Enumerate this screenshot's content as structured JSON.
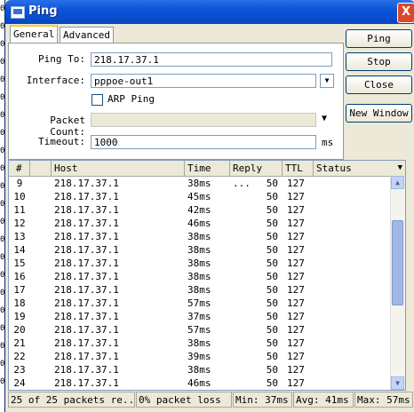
{
  "background_window": {
    "fragments": [
      "0",
      "0",
      "0",
      "0",
      "0",
      "0",
      "0",
      "0",
      "0",
      "0",
      "0",
      "0",
      "0",
      "0",
      "0",
      "0",
      "0",
      "0",
      "0",
      "0",
      "0",
      "0"
    ]
  },
  "window": {
    "title": "Ping",
    "close_glyph": "X"
  },
  "tabs": [
    {
      "label": "General"
    },
    {
      "label": "Advanced"
    }
  ],
  "form": {
    "ping_to_label": "Ping To:",
    "ping_to_value": "218.17.37.1",
    "interface_label": "Interface:",
    "interface_value": "pppoe-out1",
    "arp_ping_label": "ARP Ping",
    "packet_count_label": "Packet Count:",
    "packet_count_value": "",
    "timeout_label": "Timeout:",
    "timeout_value": "1000",
    "timeout_unit": "ms"
  },
  "buttons": {
    "ping": "Ping",
    "stop": "Stop",
    "close": "Close",
    "new_window": "New Window"
  },
  "table": {
    "columns": [
      "#",
      "Host",
      "Time",
      "Reply ...",
      "TTL",
      "Status"
    ],
    "rows": [
      {
        "n": "9",
        "host": "218.17.37.1",
        "time": "38ms",
        "reply": "50",
        "ttl": "127",
        "status": ""
      },
      {
        "n": "10",
        "host": "218.17.37.1",
        "time": "45ms",
        "reply": "50",
        "ttl": "127",
        "status": ""
      },
      {
        "n": "11",
        "host": "218.17.37.1",
        "time": "42ms",
        "reply": "50",
        "ttl": "127",
        "status": ""
      },
      {
        "n": "12",
        "host": "218.17.37.1",
        "time": "46ms",
        "reply": "50",
        "ttl": "127",
        "status": ""
      },
      {
        "n": "13",
        "host": "218.17.37.1",
        "time": "38ms",
        "reply": "50",
        "ttl": "127",
        "status": ""
      },
      {
        "n": "14",
        "host": "218.17.37.1",
        "time": "38ms",
        "reply": "50",
        "ttl": "127",
        "status": ""
      },
      {
        "n": "15",
        "host": "218.17.37.1",
        "time": "38ms",
        "reply": "50",
        "ttl": "127",
        "status": ""
      },
      {
        "n": "16",
        "host": "218.17.37.1",
        "time": "38ms",
        "reply": "50",
        "ttl": "127",
        "status": ""
      },
      {
        "n": "17",
        "host": "218.17.37.1",
        "time": "38ms",
        "reply": "50",
        "ttl": "127",
        "status": ""
      },
      {
        "n": "18",
        "host": "218.17.37.1",
        "time": "57ms",
        "reply": "50",
        "ttl": "127",
        "status": ""
      },
      {
        "n": "19",
        "host": "218.17.37.1",
        "time": "37ms",
        "reply": "50",
        "ttl": "127",
        "status": ""
      },
      {
        "n": "20",
        "host": "218.17.37.1",
        "time": "57ms",
        "reply": "50",
        "ttl": "127",
        "status": ""
      },
      {
        "n": "21",
        "host": "218.17.37.1",
        "time": "38ms",
        "reply": "50",
        "ttl": "127",
        "status": ""
      },
      {
        "n": "22",
        "host": "218.17.37.1",
        "time": "39ms",
        "reply": "50",
        "ttl": "127",
        "status": ""
      },
      {
        "n": "23",
        "host": "218.17.37.1",
        "time": "38ms",
        "reply": "50",
        "ttl": "127",
        "status": ""
      },
      {
        "n": "24",
        "host": "218.17.37.1",
        "time": "46ms",
        "reply": "50",
        "ttl": "127",
        "status": ""
      }
    ]
  },
  "statusbar": {
    "packets": "25 of 25 packets re...",
    "loss": "0% packet loss",
    "min": "Min: 37ms",
    "avg": "Avg: 41ms",
    "max": "Max: 57ms"
  },
  "colors": {
    "titlebar": "#0a55d8",
    "close_button": "#d94a2a",
    "window_bg": "#ece9d8"
  }
}
